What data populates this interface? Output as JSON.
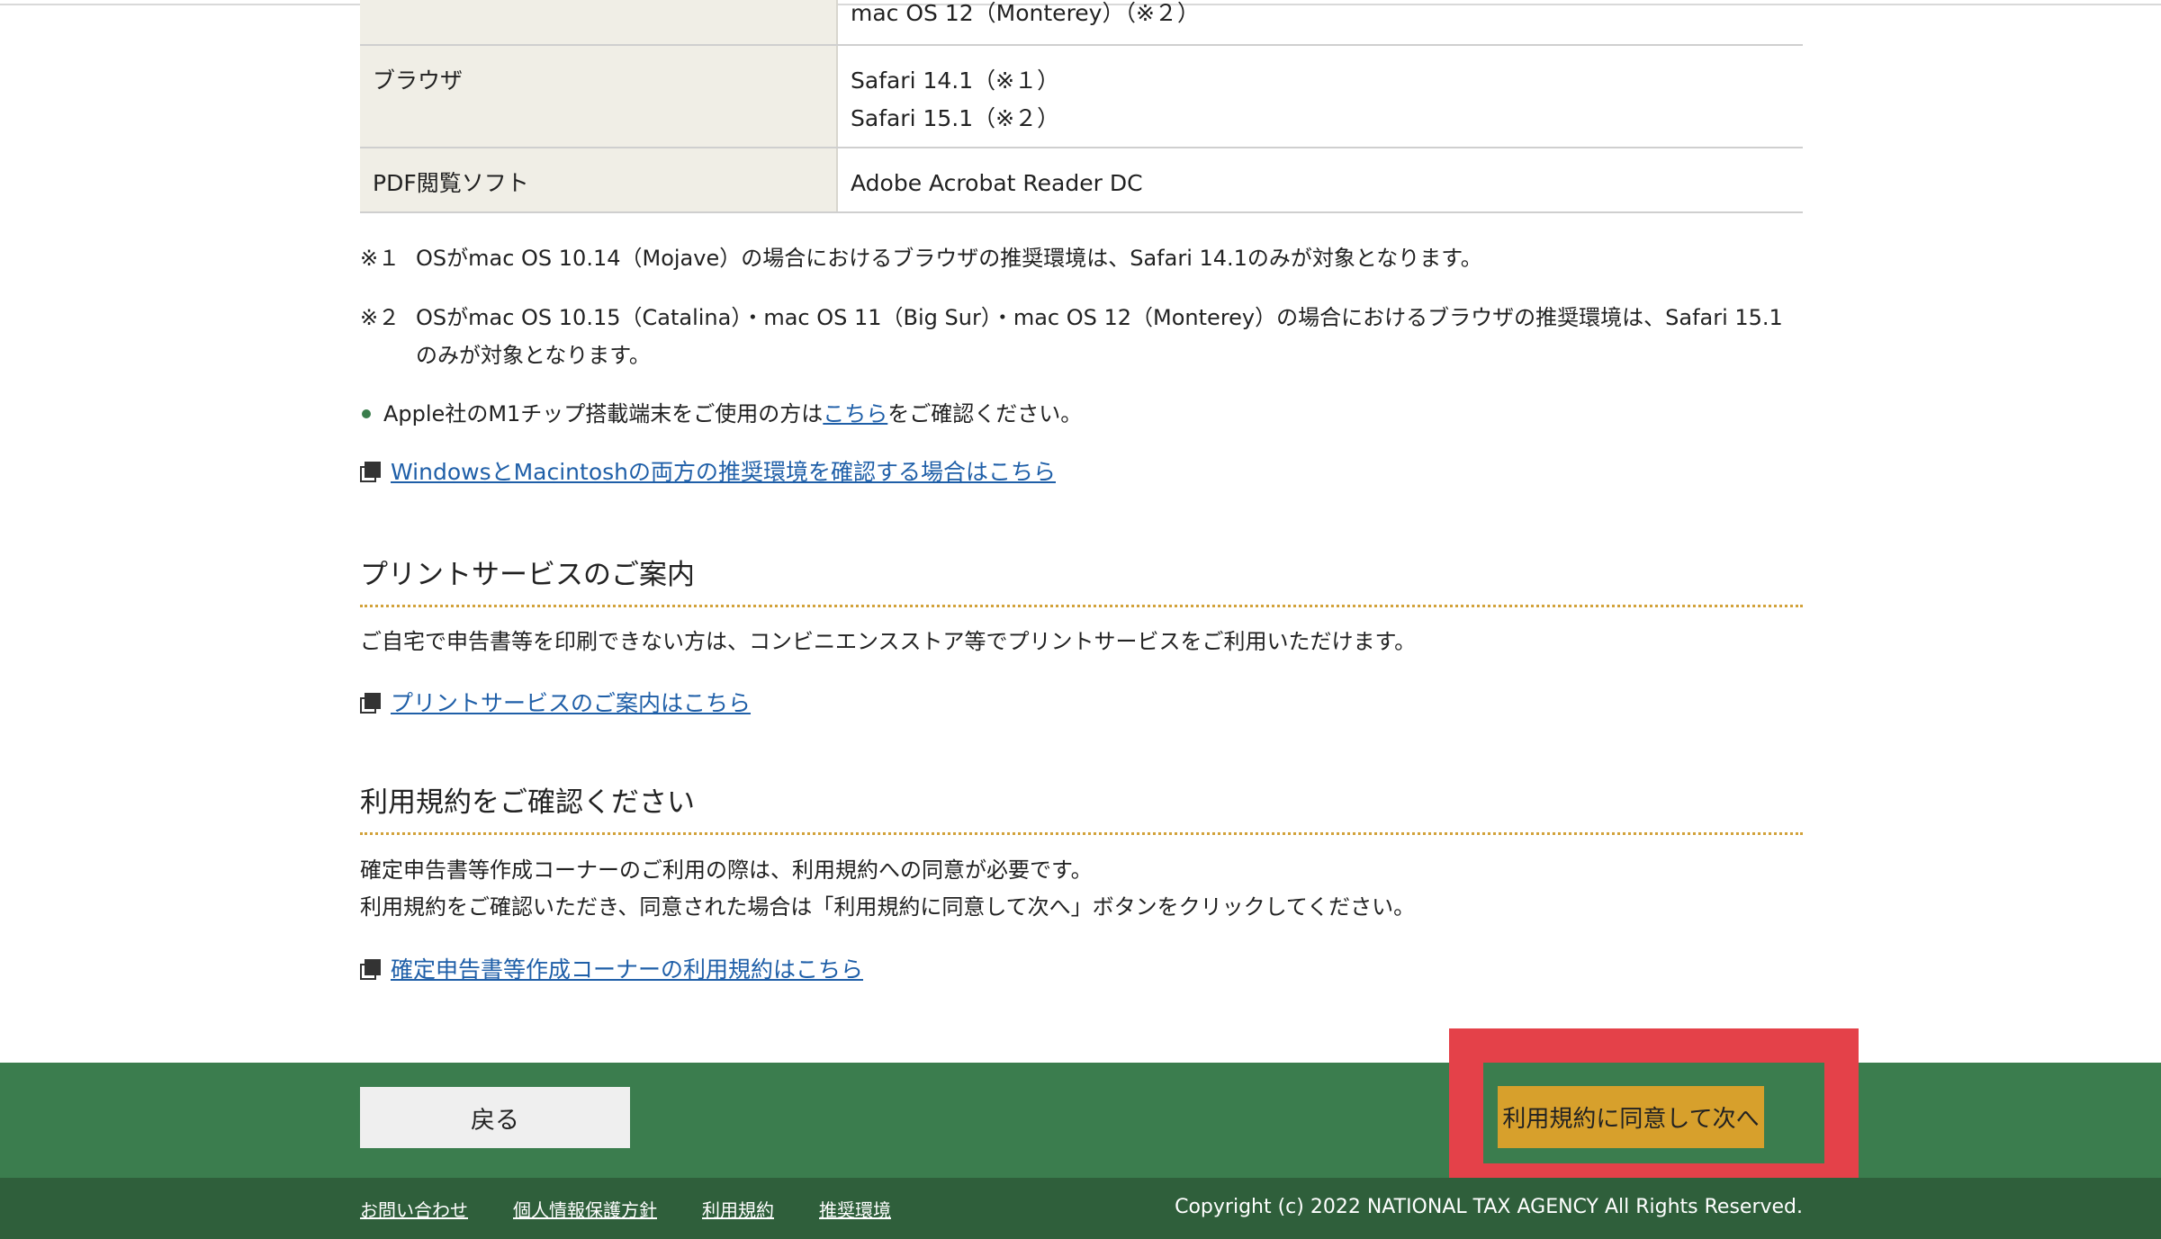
{
  "table": {
    "rows": [
      {
        "label": "",
        "values": [
          "mac OS 12（Monterey）（※２）"
        ]
      },
      {
        "label": "ブラウザ",
        "values": [
          "Safari 14.1（※１）",
          "Safari 15.1（※２）"
        ]
      },
      {
        "label": "PDF閲覧ソフト",
        "values": [
          "Adobe Acrobat Reader DC"
        ]
      }
    ]
  },
  "notes": [
    {
      "mark": "※１",
      "text": "OSがmac OS 10.14（Mojave）の場合におけるブラウザの推奨環境は、Safari 14.1のみが対象となります。"
    },
    {
      "mark": "※２",
      "text": "OSがmac OS 10.15（Catalina）・mac OS 11（Big Sur）・mac OS 12（Monterey）の場合におけるブラウザの推奨環境は、Safari 15.1のみが対象となります。"
    }
  ],
  "m1_notice": {
    "before": "Apple社のM1チップ搭載端末をご使用の方は",
    "link": "こちら",
    "after": "をご確認ください。"
  },
  "link_both_env": "WindowsとMacintoshの両方の推奨環境を確認する場合はこちら",
  "print_section": {
    "title": "プリントサービスのご案内",
    "text": "ご自宅で申告書等を印刷できない方は、コンビニエンスストア等でプリントサービスをご利用いただけます。",
    "link": "プリントサービスのご案内はこちら"
  },
  "terms_section": {
    "title": "利用規約をご確認ください",
    "line1": "確定申告書等作成コーナーのご利用の際は、利用規約への同意が必要です。",
    "line2": "利用規約をご確認いただき、同意された場合は「利用規約に同意して次へ」ボタンをクリックしてください。",
    "link": "確定申告書等作成コーナーの利用規約はこちら"
  },
  "buttons": {
    "back": "戻る",
    "agree": "利用規約に同意して次へ"
  },
  "footer": {
    "links": [
      "お問い合わせ",
      "個人情報保護方針",
      "利用規約",
      "推奨環境"
    ],
    "copyright": "Copyright (c) 2022 NATIONAL TAX AGENCY All Rights Reserved."
  },
  "colors": {
    "footer_green": "#3b7d4e",
    "footer_dark": "#2f5f3b",
    "agree_button": "#d7a02c",
    "highlight": "#e44149",
    "link": "#1f5fa8"
  }
}
